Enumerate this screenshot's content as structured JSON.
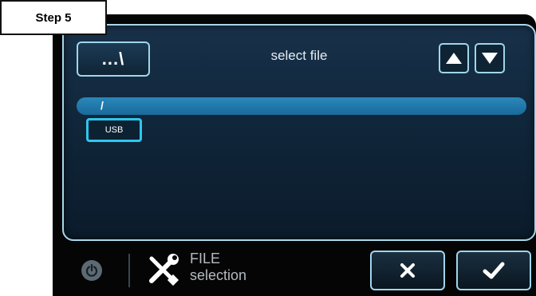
{
  "step_label": "Step 5",
  "screen": {
    "dir_button_label": "...\\",
    "title": "select file",
    "selected_path": "/",
    "items": [
      {
        "label": "USB"
      }
    ]
  },
  "bottom_bar": {
    "mode_title": "FILE",
    "mode_subtitle": "selection"
  },
  "icons": {
    "up": "triangle-up-icon",
    "down": "triangle-down-icon",
    "power": "power-icon",
    "tools": "wrench-screwdriver-icon",
    "cancel": "x-icon",
    "ok": "checkmark-icon"
  },
  "colors": {
    "accent_border": "#9fd6ea",
    "selection_bar": "#2a88bb",
    "usb_border": "#2ec7ee"
  }
}
